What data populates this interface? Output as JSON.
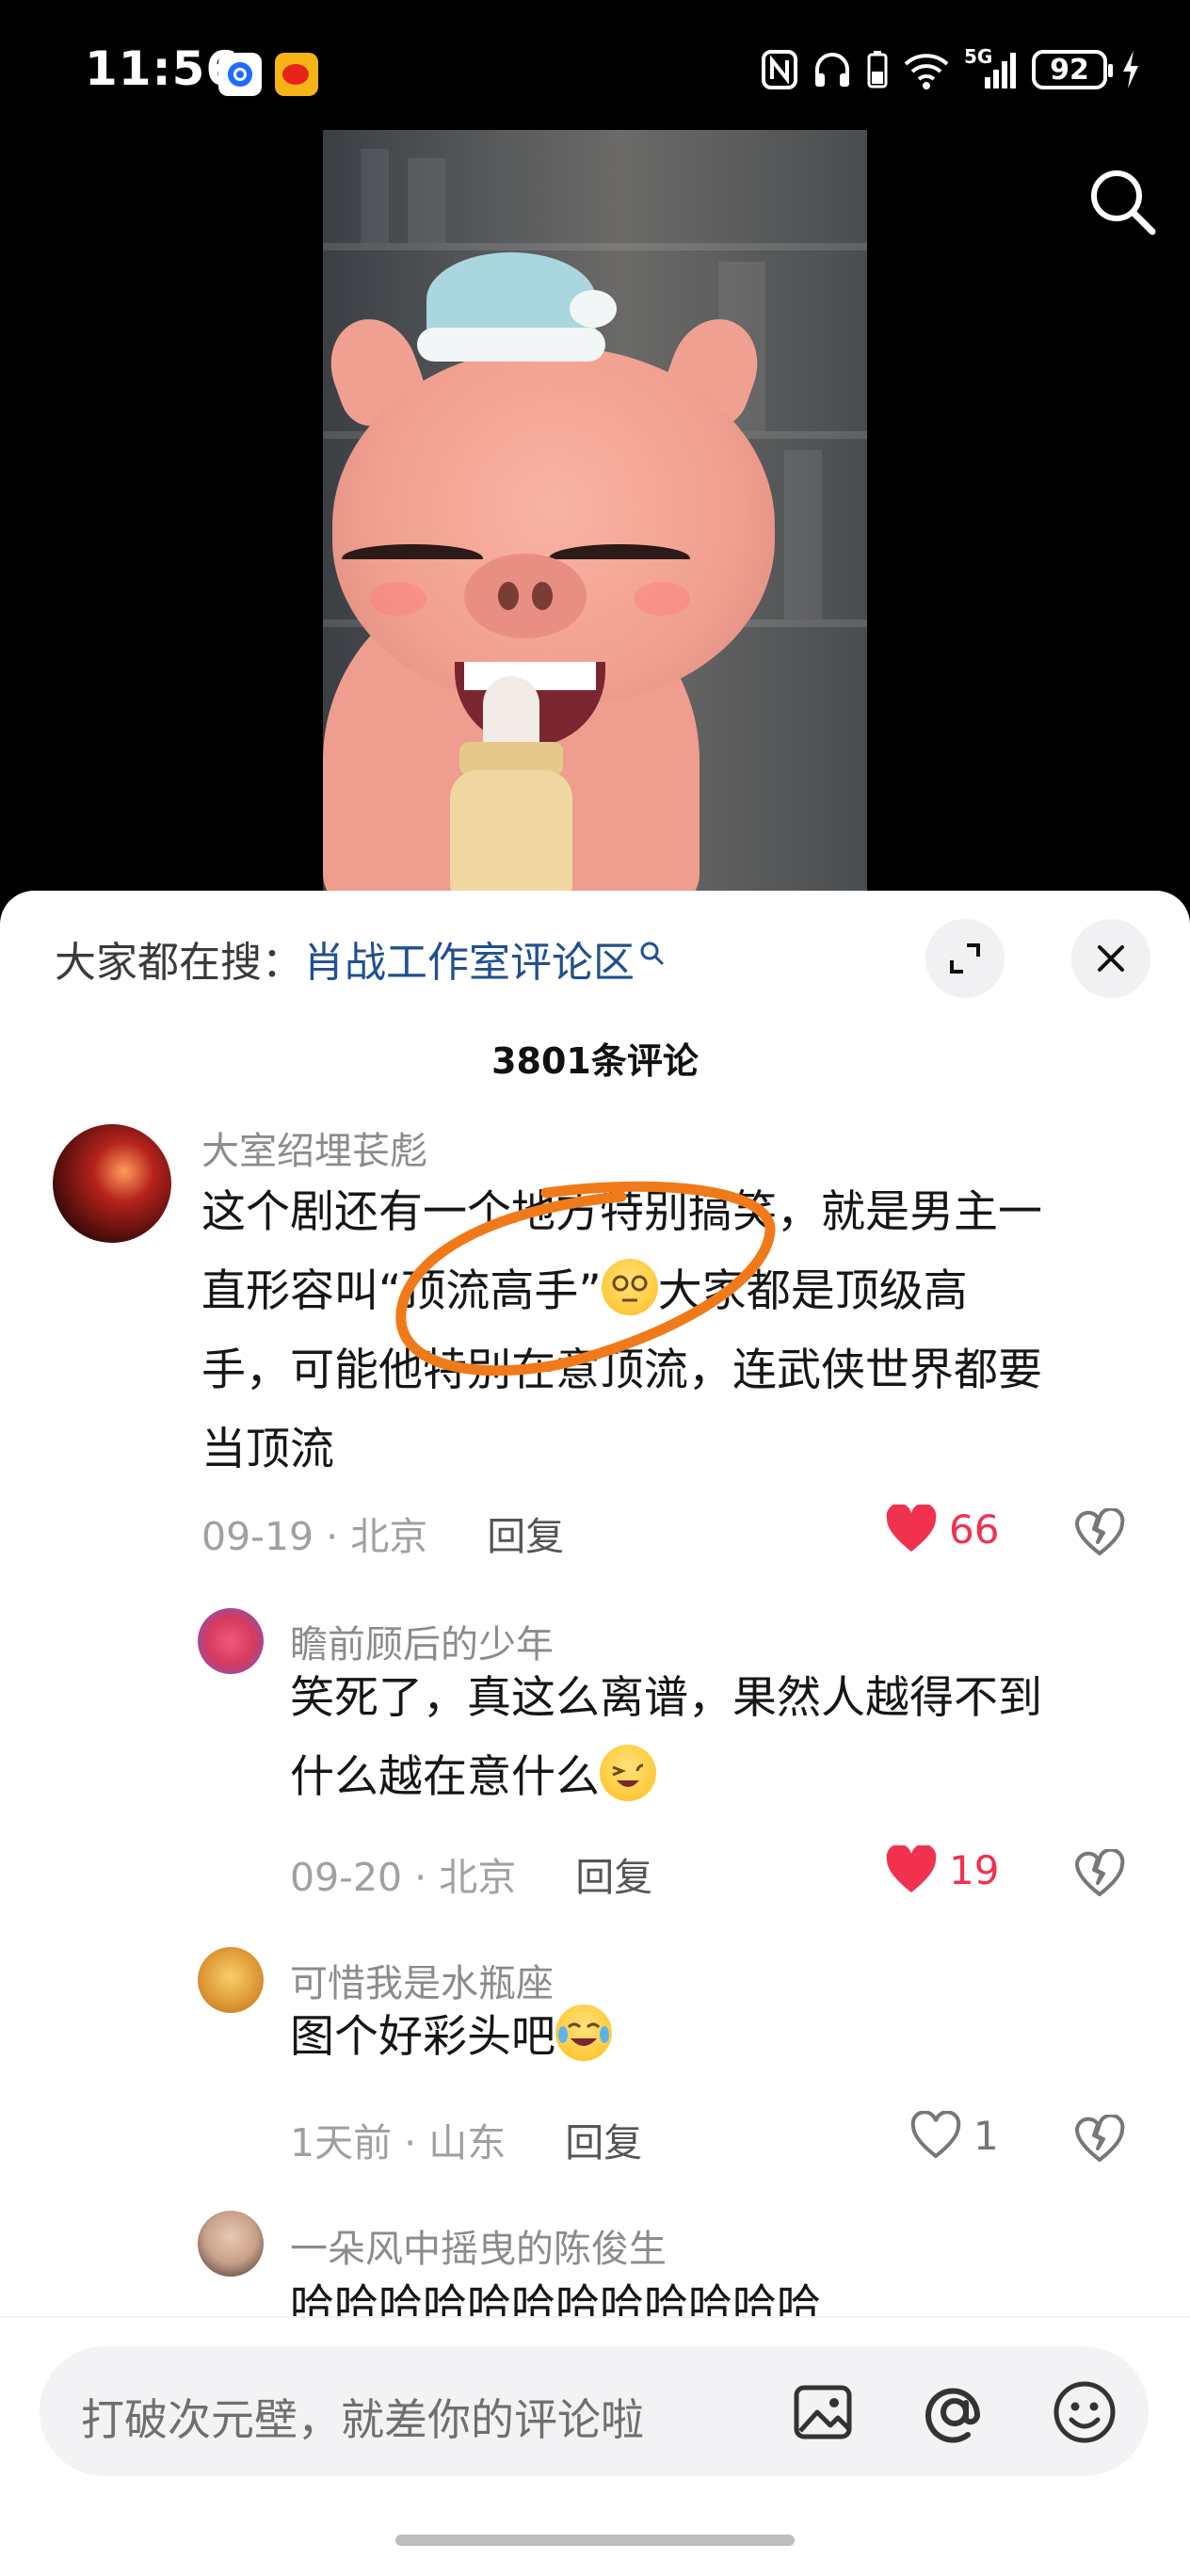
{
  "status_bar": {
    "time": "11:56",
    "battery": "92",
    "network": "5G",
    "icons": [
      "app-notification-icon",
      "weibo-icon",
      "nfc-icon",
      "headphones-icon",
      "battery-saver-icon",
      "wifi-icon",
      "signal-icon",
      "charging-icon"
    ]
  },
  "video": {
    "search_icon": "search-icon"
  },
  "comments_panel": {
    "search_prefix": "大家都在搜：",
    "search_link": "肖战工作室评论区",
    "count_text": "3801条评论",
    "expand_icon": "expand-icon",
    "close_icon": "close-icon",
    "comments": [
      {
        "username": "大室绍埋苌彪",
        "text_lines": [
          "这个剧还有一个地方特别搞笑，就是男主一",
          "直形容叫“顶流高手”",
          "大家都是顶级高",
          "手，可能他特别在意顶流，连武侠世界都要",
          "当顶流"
        ],
        "date": "09-19",
        "location": "北京",
        "reply": "回复",
        "likes": "66",
        "liked": true
      },
      {
        "username": "瞻前顾后的少年",
        "text_lines": [
          "笑死了，真这么离谱，果然人越得不到",
          "什么越在意什么"
        ],
        "date": "09-20",
        "location": "北京",
        "reply": "回复",
        "likes": "19",
        "liked": true
      },
      {
        "username": "可惜我是水瓶座",
        "text_lines": [
          "图个好彩头吧"
        ],
        "date": "1天前",
        "location": "山东",
        "reply": "回复",
        "likes": "1",
        "liked": false
      },
      {
        "username": "一朵风中摇曳的陈俊生",
        "text_lines": [
          "哈哈哈哈哈哈哈哈哈哈哈哈"
        ]
      }
    ]
  },
  "input_bar": {
    "placeholder": "打破次元壁，就差你的评论啦",
    "icons": [
      "image-icon",
      "mention-icon",
      "emoji-icon"
    ]
  },
  "colors": {
    "like_red": "#f0324f",
    "link_blue": "#20508f",
    "annotation_orange": "#f07a1a"
  }
}
